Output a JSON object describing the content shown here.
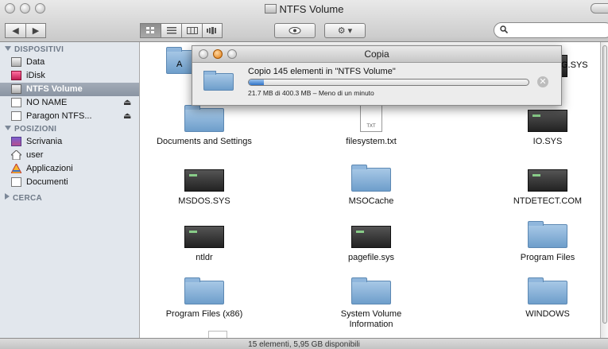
{
  "window": {
    "title": "NTFS Volume"
  },
  "toolbar": {
    "back_glyph": "◀",
    "forward_glyph": "▶",
    "view_modes": [
      "icon-view",
      "list-view",
      "column-view",
      "coverflow-view"
    ],
    "quicklook_glyph": "👁",
    "action_glyph": "⚙ ▾",
    "search_glyph": "🔍",
    "search_placeholder": ""
  },
  "sidebar": {
    "sections": [
      {
        "label": "DISPOSITIVI",
        "expanded": true
      },
      {
        "label": "POSIZIONI",
        "expanded": true
      },
      {
        "label": "CERCA",
        "expanded": false
      }
    ],
    "devices": [
      {
        "label": "Data",
        "icon": "drive-icon",
        "eject": ""
      },
      {
        "label": "iDisk",
        "icon": "idisk-icon",
        "eject": ""
      },
      {
        "label": "NTFS Volume",
        "icon": "drive-icon",
        "eject": "",
        "selected": true
      },
      {
        "label": "NO NAME",
        "icon": "disk-icon",
        "eject": "⏏"
      },
      {
        "label": "Paragon NTFS...",
        "icon": "disk-icon",
        "eject": "⏏"
      }
    ],
    "places": [
      {
        "label": "Scrivania",
        "icon": "desktop-icon"
      },
      {
        "label": "user",
        "icon": "home-icon"
      },
      {
        "label": "Applicazioni",
        "icon": "applications-icon"
      },
      {
        "label": "Documenti",
        "icon": "documents-icon"
      }
    ]
  },
  "files": [
    {
      "name": "A",
      "type": "folder"
    },
    {
      "name": "G.SYS",
      "type": "exe"
    },
    {
      "name": "Documents and Settings",
      "type": "folder"
    },
    {
      "name": "filesystem.txt",
      "type": "txt",
      "badge": "TXT"
    },
    {
      "name": "IO.SYS",
      "type": "exe"
    },
    {
      "name": "MSDOS.SYS",
      "type": "exe"
    },
    {
      "name": "MSOCache",
      "type": "folder"
    },
    {
      "name": "NTDETECT.COM",
      "type": "exe"
    },
    {
      "name": "ntldr",
      "type": "exe"
    },
    {
      "name": "pagefile.sys",
      "type": "exe"
    },
    {
      "name": "Program Files",
      "type": "folder"
    },
    {
      "name": "Program Files (x86)",
      "type": "folder"
    },
    {
      "name": "System Volume Information",
      "type": "folder"
    },
    {
      "name": "WINDOWS",
      "type": "folder"
    }
  ],
  "status_bar": {
    "text": "15 elementi, 5,95 GB disponibili"
  },
  "copy_dialog": {
    "title": "Copia",
    "message": "Copio 145 elementi in \"NTFS Volume\"",
    "detail": "21.7 MB di 400.3 MB – Meno di un minuto",
    "progress": 0.054,
    "stop_glyph": "✕"
  },
  "colors": {
    "sidebar_bg": "#e2e7ed",
    "selection": "#8a94a2",
    "progress": "#2f73c8",
    "folder": "#6e9ecb"
  }
}
